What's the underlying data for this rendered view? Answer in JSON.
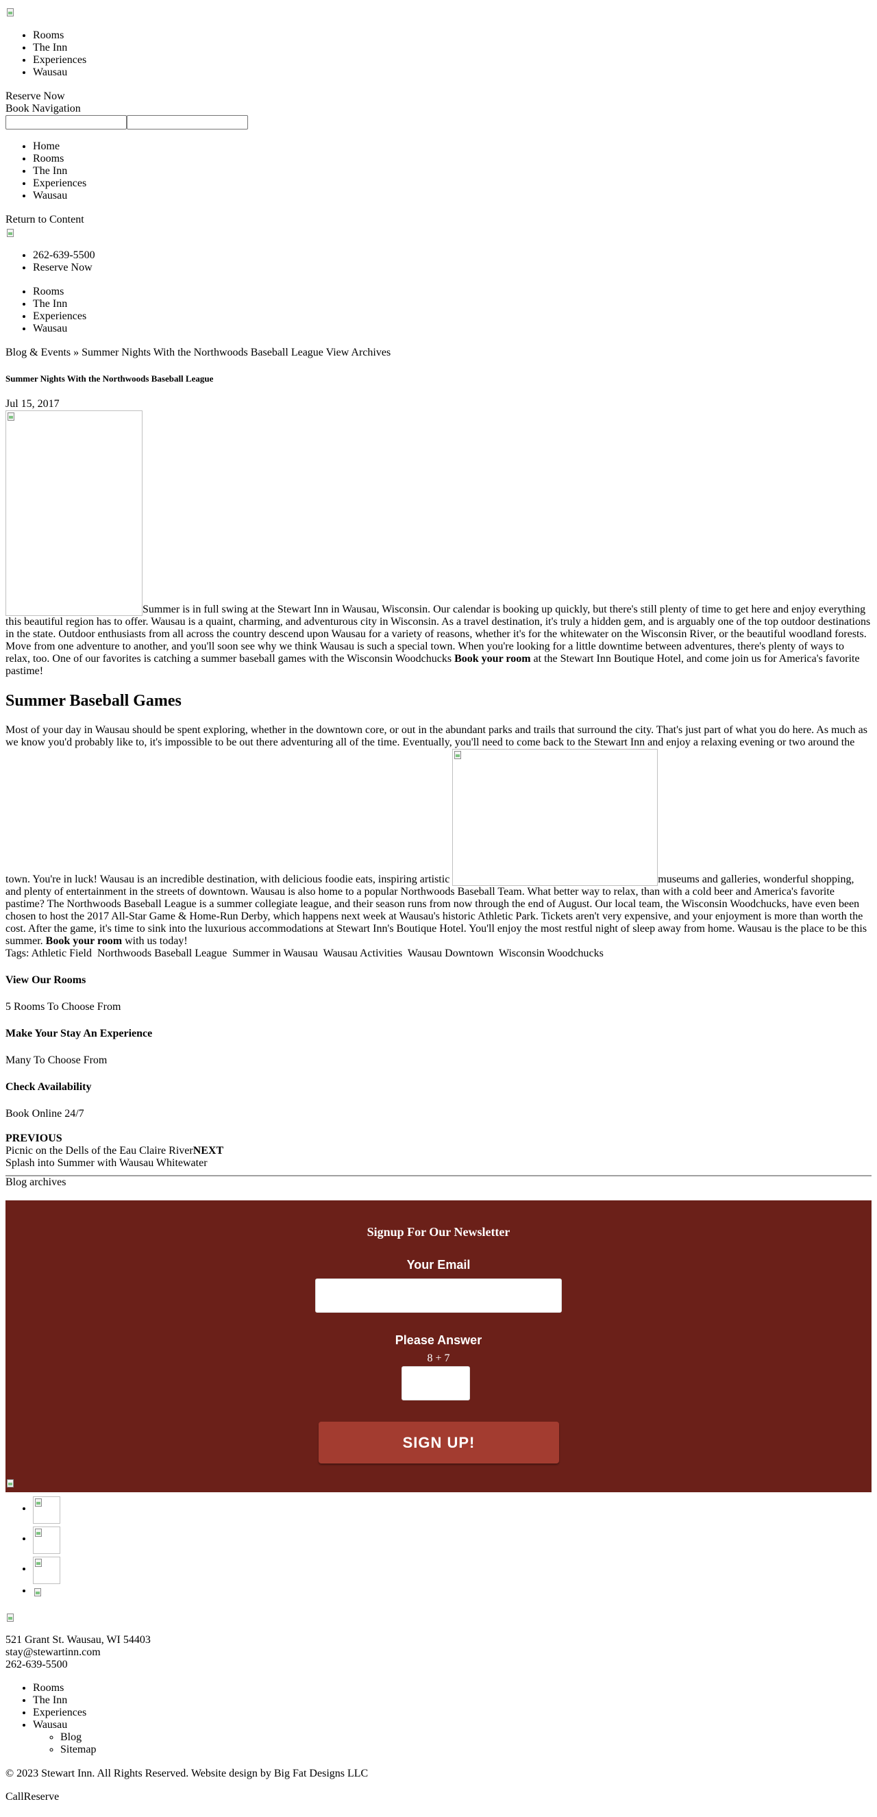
{
  "header": {
    "nav": [
      "Rooms",
      "The Inn",
      "Experiences",
      "Wausau"
    ],
    "reserve_now": "Reserve Now",
    "book_navigation": "Book Navigation"
  },
  "mobile_menu": {
    "items": [
      "Home",
      "Rooms",
      "The Inn",
      "Experiences",
      "Wausau"
    ],
    "return_to_content": "Return to Content"
  },
  "contact_bar": {
    "phone": "262-639-5500",
    "reserve_now": "Reserve Now"
  },
  "main_nav": [
    "Rooms",
    "The Inn",
    "Experiences",
    "Wausau"
  ],
  "breadcrumb": {
    "section": "Blog & Events",
    "separator": "»",
    "current": "Summer Nights With the Northwoods Baseball League",
    "view_archives": "View Archives"
  },
  "post": {
    "title": "Summer Nights With the Northwoods Baseball League",
    "date": "Jul 15, 2017",
    "intro": "Summer is in full swing at the Stewart Inn in Wausau, Wisconsin.  Our calendar is booking up quickly, but there's still plenty of time to get here and enjoy everything this beautiful region has to offer. Wausau is a quaint, charming, and adventurous city in Wisconsin. As a travel destination, it's truly a hidden gem, and is arguably one of the top outdoor destinations in the state. Outdoor enthusiasts from all across the country descend upon Wausau for a variety of reasons, whether it's for the whitewater on the Wisconsin River, or the beautiful woodland forests.  Move from one adventure to another, and you'll soon see why we think Wausau is such a special town.  When you're looking for a little downtime between adventures, there's plenty of ways to relax, too.  One of our favorites is catching a summer baseball games with the Wisconsin Woodchucks ",
    "intro_link": "Book your room",
    "intro_end": " at the Stewart Inn Boutique Hotel, and come join us for America's favorite pastime!",
    "section_heading": "Summer Baseball Games",
    "body_1": "Most of your day in Wausau should be spent exploring, whether in the downtown core, or out in the abundant parks and trails that surround the city.  That's just part of what you do here.  As much as we know you'd probably like to, it's impossible to be out there adventuring all of the time.  Eventually, you'll need to come back to the Stewart Inn and enjoy a relaxing evening or two around the town. You're in luck!  Wausau is an incredible destination, with delicious foodie eats, inspiring artistic ",
    "body_2": "museums and galleries, wonderful shopping, and plenty of entertainment in the streets of downtown. Wausau is also home to a popular Northwoods Baseball Team.  What better way to relax, than with a cold beer and America's favorite pastime? The Northwoods Baseball League is a summer collegiate league, and their season runs from now through the end of August. Our local team, the Wisconsin Woodchucks, have even been chosen to host the 2017 All-Star Game & Home-Run Derby, which happens next week at Wausau's historic Athletic Park.  Tickets aren't very expensive, and your enjoyment is more than worth the cost. After the game, it's time to sink into the luxurious accommodations at Stewart Inn's Boutique Hotel.  You'll enjoy the most restful night of sleep away from home.  Wausau is the place to be this summer. ",
    "body_link": "Book your room",
    "body_end": " with us today!",
    "tags_label": "Tags:",
    "tags": [
      "Athletic Field",
      "Northwoods Baseball League",
      "Summer in Wausau",
      "Wausau Activities",
      "Wausau Downtown",
      "Wisconsin Woodchucks"
    ]
  },
  "ctas": [
    {
      "title": "View Our Rooms",
      "subtitle": "5 Rooms To Choose From"
    },
    {
      "title": "Make Your Stay An Experience",
      "subtitle": "Many To Choose From"
    },
    {
      "title": "Check Availability",
      "subtitle": "Book Online 24/7"
    }
  ],
  "post_nav": {
    "previous_label": "PREVIOUS",
    "previous_title": "Picnic on the Dells of the Eau Claire River",
    "next_label": "NEXT",
    "next_title": "Splash into Summer with Wausau Whitewater"
  },
  "blog_archives": "Blog archives",
  "newsletter": {
    "title": "Signup For Our Newsletter",
    "email_label": "Your Email",
    "email_value": "",
    "question_label": "Please Answer",
    "question": "8 + 7",
    "answer_value": "",
    "button": "SIGN UP!",
    "background": "#6b2019",
    "button_color": "#a33c30"
  },
  "social_icons": [
    "facebook-icon",
    "instagram-icon",
    "twitter-icon",
    "tripadvisor-icon"
  ],
  "footer": {
    "address": "521 Grant St. Wausau, WI 54403",
    "email": "stay@stewartinn.com",
    "phone": "262-639-5500",
    "nav": [
      "Rooms",
      "The Inn",
      "Experiences",
      "Wausau"
    ],
    "sub_nav": [
      "Blog",
      "Sitemap"
    ],
    "copyright": "© 2023 Stewart Inn. All Rights Reserved. Website design by Big Fat Designs LLC",
    "call": "Call",
    "reserve": "Reserve"
  }
}
